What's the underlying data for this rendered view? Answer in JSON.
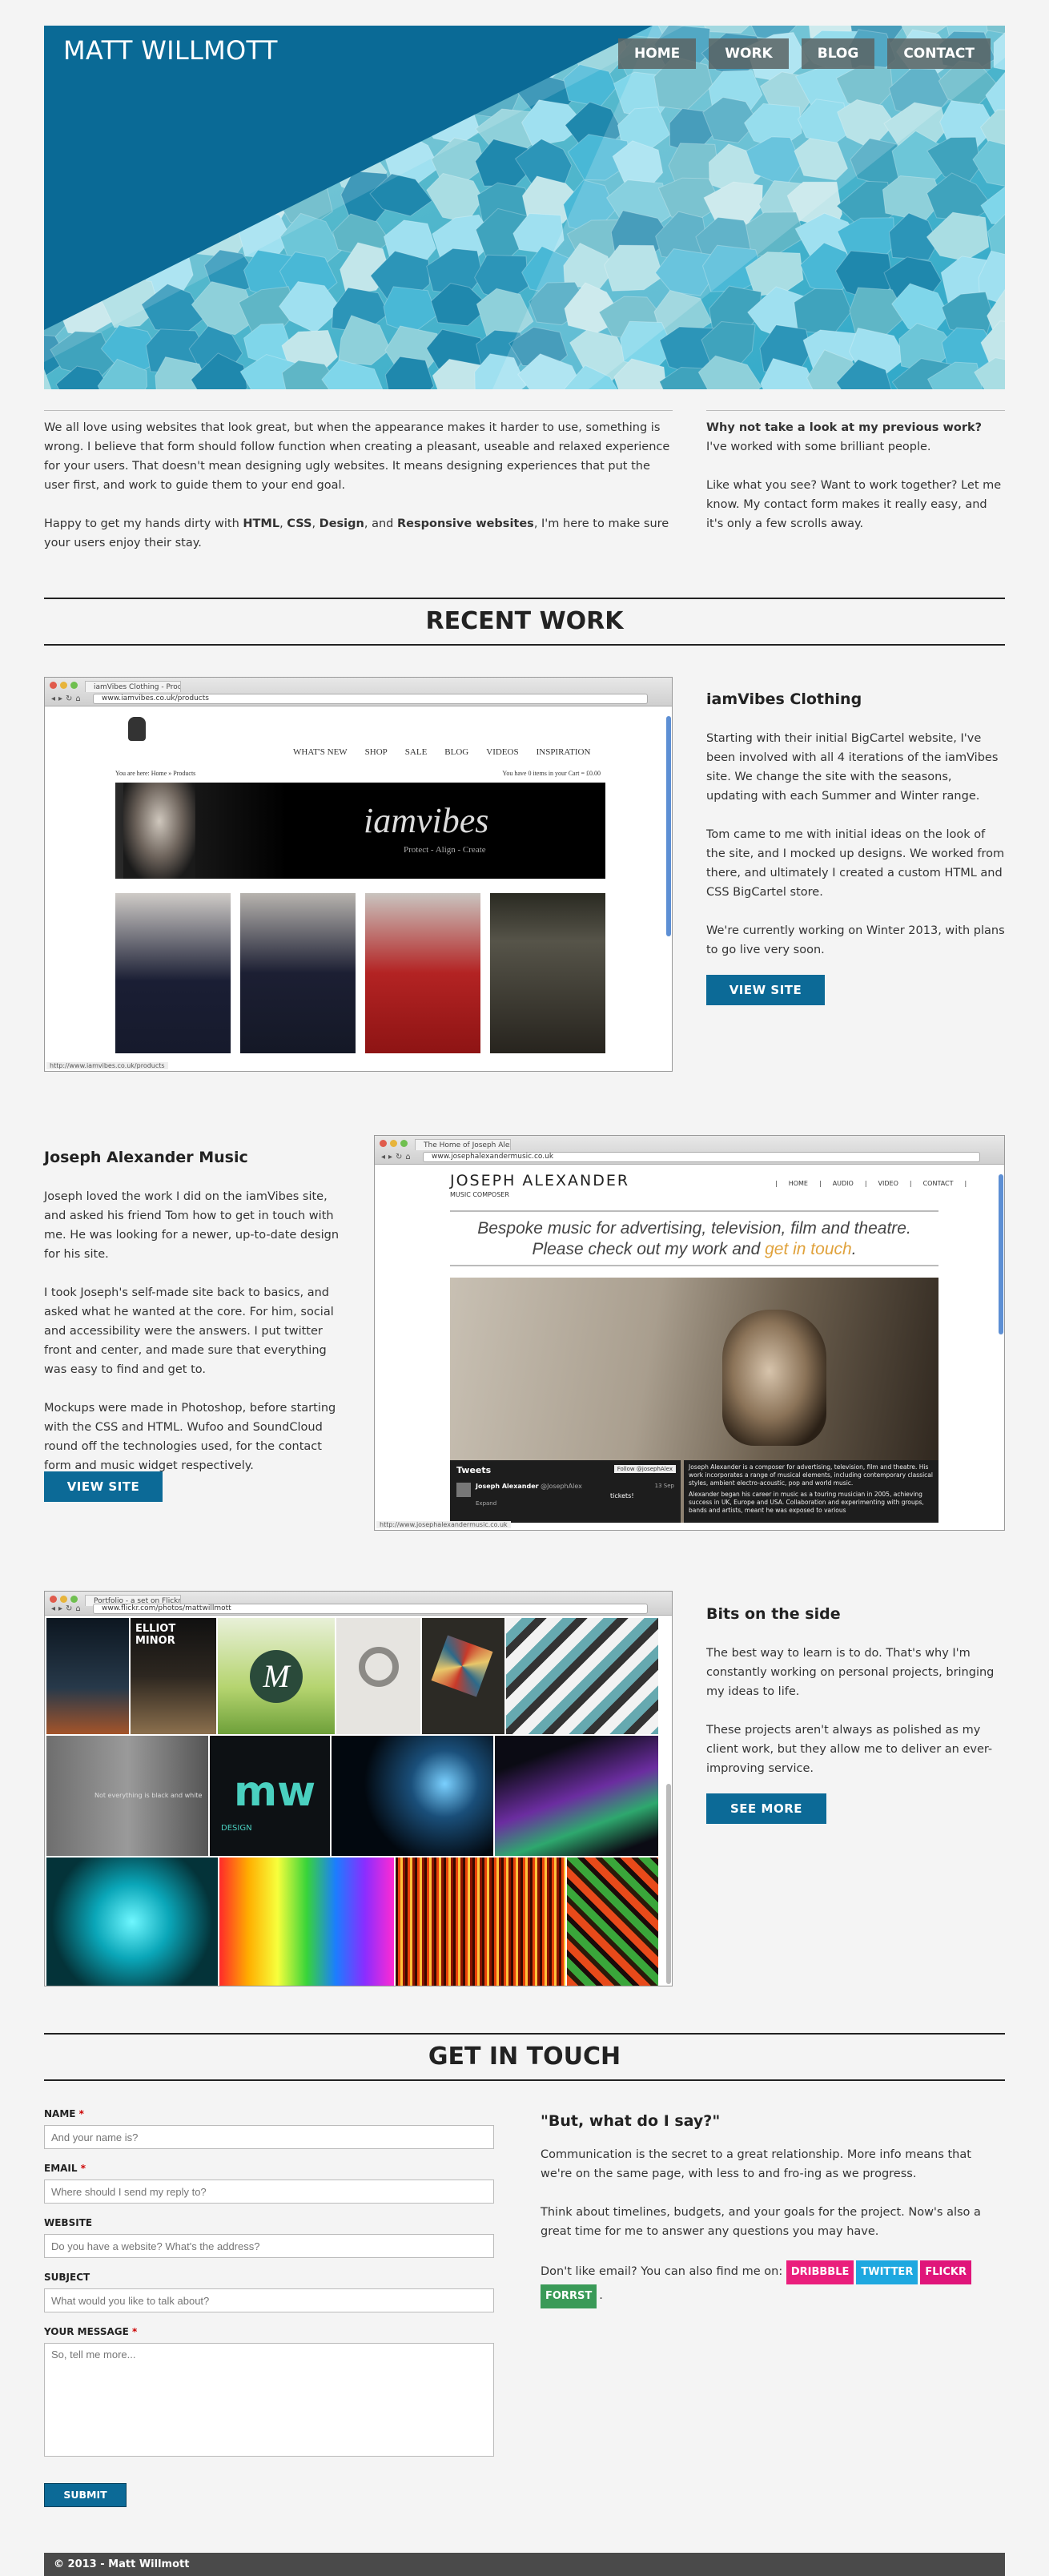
{
  "site": {
    "title": "MATT WILLMOTT",
    "nav": [
      "HOME",
      "WORK",
      "BLOG",
      "CONTACT"
    ]
  },
  "intro": {
    "p1": "We all love using websites that look great, but when the appearance makes it harder to use, something is wrong. I believe that form should follow function when creating a pleasant, useable and relaxed experience for your users. That doesn't mean designing ugly websites. It means designing experiences that put the user first, and work to guide them to your end goal.",
    "p2_pre": "Happy to get my hands dirty with ",
    "p2_html": "HTML",
    "p2_c1": ", ",
    "p2_css": "CSS",
    "p2_c2": ", ",
    "p2_design": "Design",
    "p2_and": ", and ",
    "p2_resp": "Responsive websites",
    "p2_post": ", I'm here to make sure your users enjoy their stay.",
    "right_bold": "Why not take a look at my previous work?",
    "right_rest": " I've worked with some brilliant people.",
    "right_p2": "Like what you see? Want to work together? Let me know. My contact form makes it really easy, and it's only a few scrolls away."
  },
  "recent_work": {
    "heading": "RECENT WORK",
    "projects": [
      {
        "title": "iamVibes Clothing",
        "tab": "iamVibes Clothing - Produ...",
        "url": "www.iamvibes.co.uk/products",
        "paras": [
          "Starting with their initial BigCartel website, I've been involved with all 4 iterations of the iamVibes site. We change the site with the seasons, updating with each Summer and Winter range.",
          "Tom came to me with initial ideas on the look of the site, and I mocked up designs. We worked from there, and ultimately I created a custom HTML and CSS BigCartel store.",
          "We're currently working on Winter 2013, with plans to go live very soon."
        ],
        "button": "VIEW SITE",
        "shot": {
          "menu": [
            "WHAT'S NEW",
            "SHOP",
            "SALE",
            "BLOG",
            "VIDEOS",
            "INSPIRATION"
          ],
          "breadcrumb": "You are here:  Home » Products",
          "cart": "You have 0 items in your Cart = £0.00",
          "banner_logo": "iamvibes",
          "banner_tag": "Protect - Align - Create",
          "status": "http://www.iamvibes.co.uk/products"
        }
      },
      {
        "title": "Joseph Alexander Music",
        "tab": "The Home of Joseph Alexa...",
        "url": "www.josephalexandermusic.co.uk",
        "paras": [
          "Joseph loved the work I did on the iamVibes site, and asked his friend Tom how to get in touch with me. He was looking for a newer, up-to-date design for his site.",
          "I took Joseph's self-made site back to basics, and asked what he wanted at the core. For him, social and accessibility were the answers. I put twitter front and center, and made sure that everything was easy to find and get to.",
          "Mockups were made in Photoshop, before starting with the CSS and HTML. Wufoo and SoundCloud round off the technologies used, for the contact form and music widget respectively."
        ],
        "button": "VIEW SITE",
        "shot": {
          "name": "JOSEPH ALEXANDER",
          "subtitle": "MUSIC COMPOSER",
          "menu": [
            "HOME",
            "AUDIO",
            "VIDEO",
            "CONTACT"
          ],
          "tagline_pre": "Bespoke music for advertising, television, film and theatre. Please check out my work and ",
          "tagline_link": "get in touch",
          "tagline_post": ".",
          "tweets_label": "Tweets",
          "follow": "Follow @josephAlex",
          "tweet_user": "Joseph Alexander",
          "tweet_handle": "@JosephAlex",
          "tweet_date": "13 Sep",
          "tweet_text": "tickets!",
          "tweet_expand": "Expand",
          "bio1": "Joseph Alexander is a composer for advertising, television, film and theatre. His work incorporates a range of musical elements, including contemporary classical styles, ambient electro-acoustic, pop and world music.",
          "bio2": "Alexander began his career in music as a touring musician in 2005, achieving success in UK, Europe and USA. Collaboration and experimenting with groups, bands and artists, meant he was exposed to various",
          "status": "http://www.josephalexandermusic.co.uk"
        }
      },
      {
        "title": "Bits on the side",
        "tab": "Portfolio - a set on Flickr",
        "url": "www.flickr.com/photos/mattwillmott",
        "paras": [
          "The best way to learn is to do. That's why I'm constantly working on personal projects, bringing my ideas to life.",
          "These projects aren't always as polished as my client work, but they allow me to deliver an ever-improving service."
        ],
        "button": "SEE MORE",
        "shot": {
          "album": "ELLIOT MINOR",
          "wall_text": "Not everything is black and white",
          "mw_text": "DESIGN"
        }
      }
    ]
  },
  "contact": {
    "heading": "GET IN TOUCH",
    "fields": [
      {
        "label": "NAME",
        "required": "*",
        "placeholder": "And your name is?"
      },
      {
        "label": "EMAIL",
        "required": "*",
        "placeholder": "Where should I send my reply to?"
      },
      {
        "label": "WEBSITE",
        "required": "",
        "placeholder": "Do you have a website? What's the address?"
      },
      {
        "label": "SUBJECT",
        "required": "",
        "placeholder": "What would you like to talk about?"
      },
      {
        "label": "YOUR MESSAGE",
        "required": "*",
        "placeholder": "So, tell me more..."
      }
    ],
    "submit": "SUBMIT",
    "right_heading": "\"But, what do I say?\"",
    "right_p1": "Communication is the secret to a great relationship. More info means that we're on the same page, with less to and fro-ing as we progress.",
    "right_p2": "Think about timelines, budgets, and your goals for the project. Now's also a great time for me to answer any questions you may have.",
    "right_p3": "Don't like email? You can also find me on:",
    "socials": [
      {
        "label": "DRIBBBLE",
        "color": "#ea1e7c"
      },
      {
        "label": "TWITTER",
        "color": "#1ea8e0"
      },
      {
        "label": "FLICKR",
        "color": "#e0157a"
      },
      {
        "label": "FORRST",
        "color": "#3a9a58"
      }
    ],
    "social_end": "."
  },
  "footer": {
    "text": "© 2013 - Matt Willmott"
  },
  "colors": {
    "accent": "#0c6a97",
    "footer": "#4a4a4a"
  }
}
